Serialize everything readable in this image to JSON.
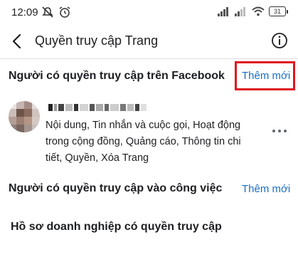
{
  "status_bar": {
    "time": "12:09",
    "left_icons": [
      "mute-icon",
      "alarm-icon"
    ],
    "right_icons": [
      "signal-icon",
      "signal-icon",
      "wifi-icon",
      "battery-icon"
    ],
    "battery": "31"
  },
  "app_bar": {
    "title": "Quyền truy cập Trang",
    "back_icon": "back-arrow-icon",
    "info_icon": "info-icon"
  },
  "facebook_access": {
    "header": "Người có quyền truy cập trên Facebook",
    "add_label": "Thêm mới",
    "highlight_color": "#e0141e",
    "people": [
      {
        "permissions": "Nội dung, Tin nhắn và cuộc gọi, Hoạt động trong cộng đồng, Quảng cáo, Thông tin chi tiết, Quyền, Xóa Trang"
      }
    ]
  },
  "task_access": {
    "header": "Người có quyền truy cập vào công việc",
    "add_label": "Thêm mới"
  },
  "business_access": {
    "header": "Hồ sơ doanh nghiệp có quyền truy cập"
  },
  "colors": {
    "link": "#1a6fc4",
    "text": "#1c1e21",
    "divider": "#dddfe2"
  }
}
